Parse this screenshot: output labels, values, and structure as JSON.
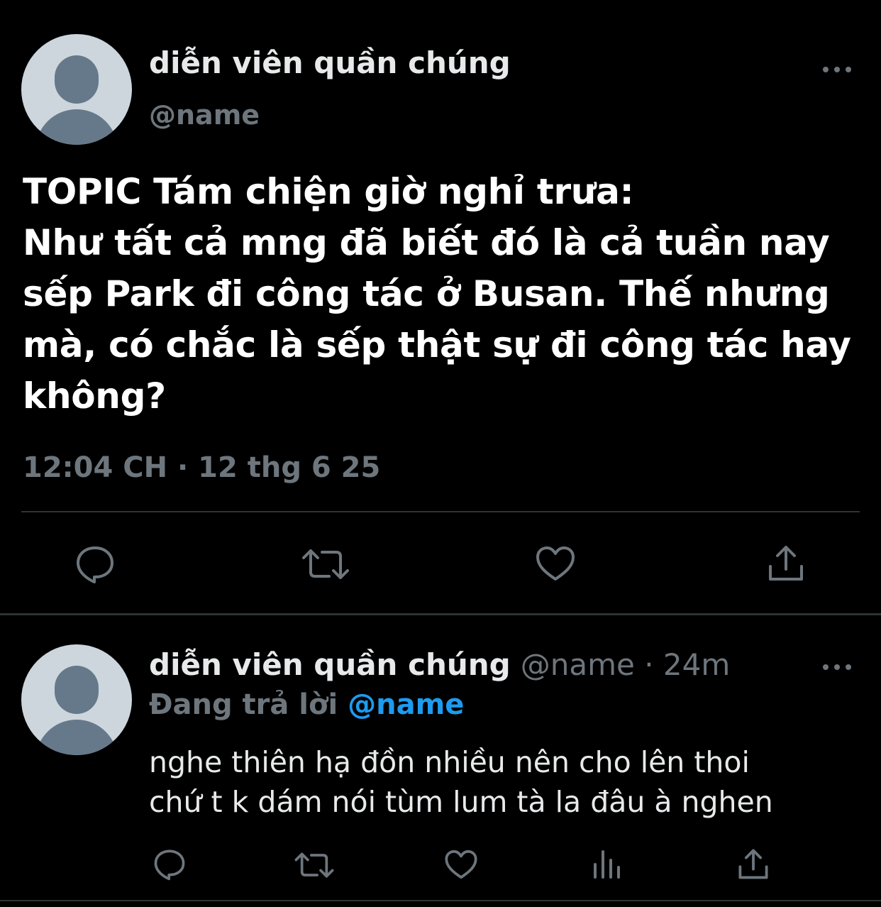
{
  "colors": {
    "background": "#000000",
    "text_primary": "#e7e9ea",
    "text_secondary": "#6e767d",
    "mention": "#1d9bf0",
    "divider": "#2f3336",
    "avatar_bg": "#cdd6dd",
    "avatar_fg": "#66798a"
  },
  "main_tweet": {
    "author_name": "diễn viên quần chúng",
    "author_handle": "@name",
    "text": "TOPIC Tám chiện giờ nghỉ trưa:\nNhư tất cả mng đã biết đó là cả tuần nay sếp Park đi công tác ở Busan. Thế nhưng mà, có chắc là sếp thật sự đi công tác hay không?",
    "timestamp": "12:04 CH · 12 thg 6 25",
    "more_icon": "more-horizontal-icon",
    "actions": [
      {
        "name": "reply",
        "icon": "reply-icon"
      },
      {
        "name": "retweet",
        "icon": "retweet-icon"
      },
      {
        "name": "like",
        "icon": "heart-icon"
      },
      {
        "name": "share",
        "icon": "share-icon"
      }
    ]
  },
  "reply_tweet": {
    "author_name": "diễn viên quần chúng",
    "meta": "@name · 24m",
    "replying_label": "Đang trả lời",
    "replying_to": "@name",
    "text": "nghe thiên hạ đồn nhiều nên cho lên thoi\nchứ t k dám nói tùm lum tà la đâu à nghen",
    "more_icon": "more-horizontal-icon",
    "actions": [
      {
        "name": "reply",
        "icon": "reply-icon"
      },
      {
        "name": "retweet",
        "icon": "retweet-icon"
      },
      {
        "name": "like",
        "icon": "heart-icon"
      },
      {
        "name": "analytics",
        "icon": "analytics-icon"
      },
      {
        "name": "share",
        "icon": "share-icon"
      }
    ]
  }
}
